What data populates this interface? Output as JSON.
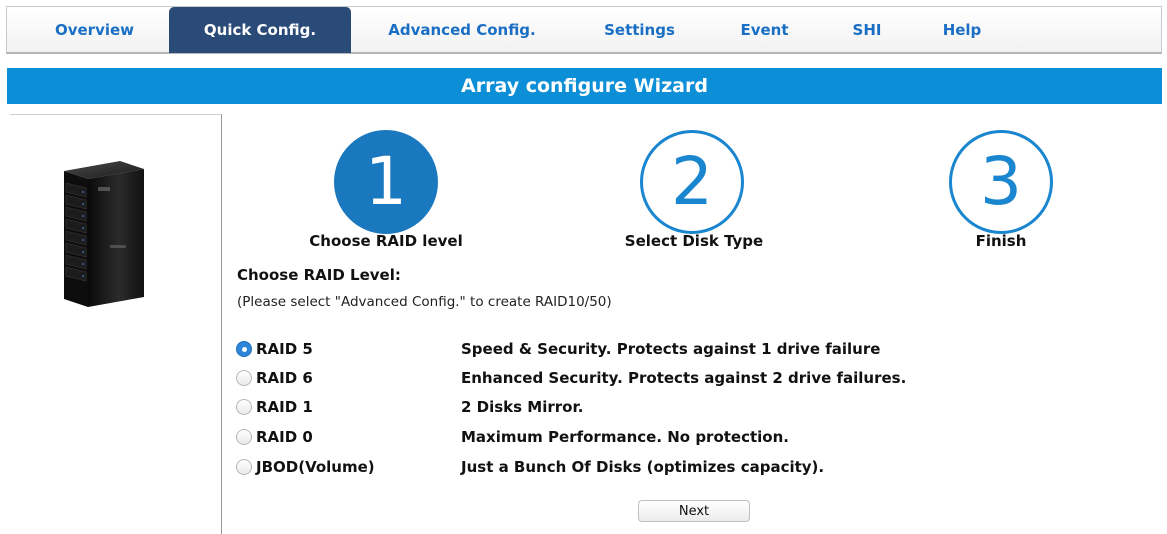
{
  "nav": {
    "tabs": [
      {
        "label": "Overview"
      },
      {
        "label": "Quick Config."
      },
      {
        "label": "Advanced Config."
      },
      {
        "label": "Settings"
      },
      {
        "label": "Event"
      },
      {
        "label": "SHI"
      },
      {
        "label": "Help"
      }
    ],
    "active_tab": "Quick Config."
  },
  "wizard": {
    "title": "Array configure Wizard",
    "steps": [
      {
        "number": "1",
        "label": "Choose RAID level",
        "active": true
      },
      {
        "number": "2",
        "label": "Select Disk Type",
        "active": false
      },
      {
        "number": "3",
        "label": "Finish",
        "active": false
      }
    ],
    "section_title": "Choose RAID Level:",
    "section_note": "(Please select \"Advanced Config.\" to create RAID10/50)",
    "options": [
      {
        "name": "RAID 5",
        "description": "Speed & Security. Protects against 1 drive failure",
        "selected": true
      },
      {
        "name": "RAID 6",
        "description": "Enhanced Security. Protects against 2 drive failures.",
        "selected": false
      },
      {
        "name": "RAID 1",
        "description": "2 Disks Mirror.",
        "selected": false
      },
      {
        "name": "RAID 0",
        "description": "Maximum Performance. No protection.",
        "selected": false
      },
      {
        "name": "JBOD(Volume)",
        "description": "Just a Bunch Of Disks (optimizes capacity).",
        "selected": false
      }
    ],
    "next_label": "Next"
  },
  "colors": {
    "nav_active_bg": "#2a4a78",
    "link_blue": "#1a6fc4",
    "title_bar_bg": "#0d8fd8",
    "step_blue": "#1a78bf"
  }
}
